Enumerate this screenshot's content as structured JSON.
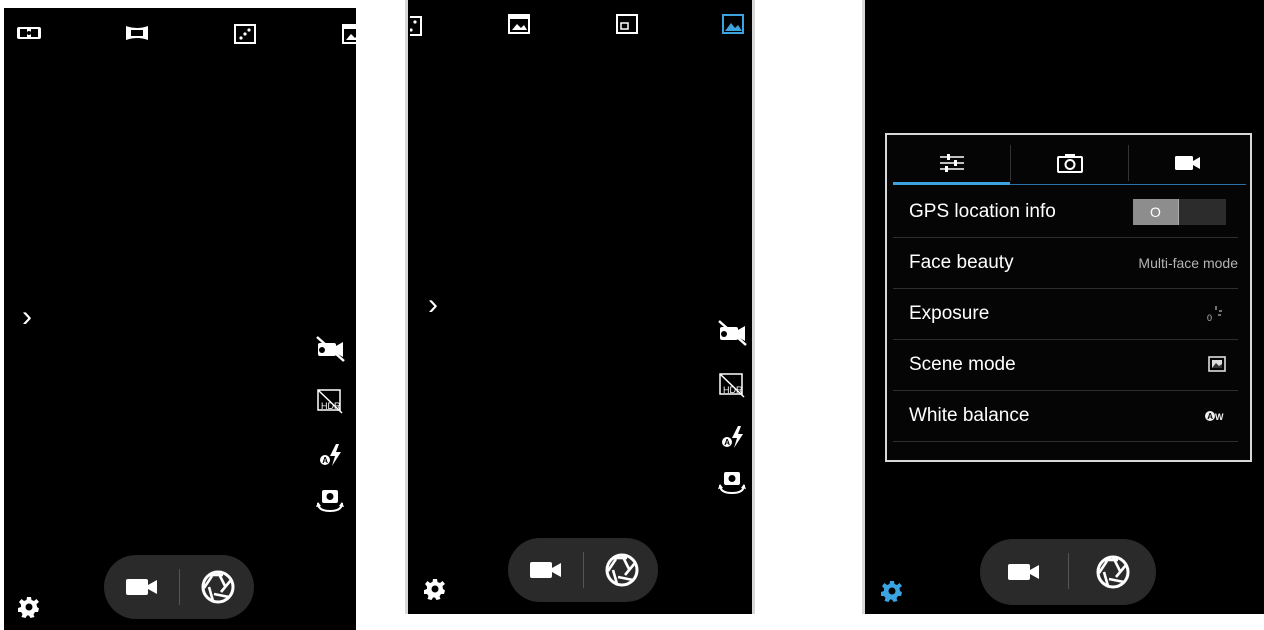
{
  "screens": [
    {
      "id": "camera-main",
      "expand_glyph": "›"
    },
    {
      "id": "camera-modes-scrolled",
      "expand_glyph": "›"
    },
    {
      "id": "camera-settings"
    }
  ],
  "mode_icons": [
    "dual-camera-icon",
    "panorama-icon",
    "live-effect-icon",
    "slideshow-icon",
    "picture-in-picture-icon",
    "landscape-mode-icon"
  ],
  "side_controls": [
    "video-off-icon",
    "hdr-off-icon",
    "auto-flash-icon",
    "switch-camera-icon"
  ],
  "bottom_controls": {
    "video": "video-camera-icon",
    "shutter": "shutter-icon",
    "settings": "gear-icon"
  },
  "settings_panel": {
    "tabs": [
      "sliders-icon",
      "camera-icon",
      "video-camera-icon"
    ],
    "rows": [
      {
        "label": "GPS location info",
        "value_type": "toggle",
        "toggle_glyph": "O"
      },
      {
        "label": "Face beauty",
        "value": "Multi-face mode"
      },
      {
        "label": "Exposure",
        "value_icon": "exposure-icon"
      },
      {
        "label": "Scene mode",
        "value_icon": "scene-icon"
      },
      {
        "label": "White balance",
        "value_icon": "auto-white-balance-icon"
      }
    ]
  },
  "colors": {
    "active_blue": "#3ba3e0",
    "background": "#000000",
    "pill": "#2a2a2a",
    "panel_border": "#d8d8d8"
  }
}
